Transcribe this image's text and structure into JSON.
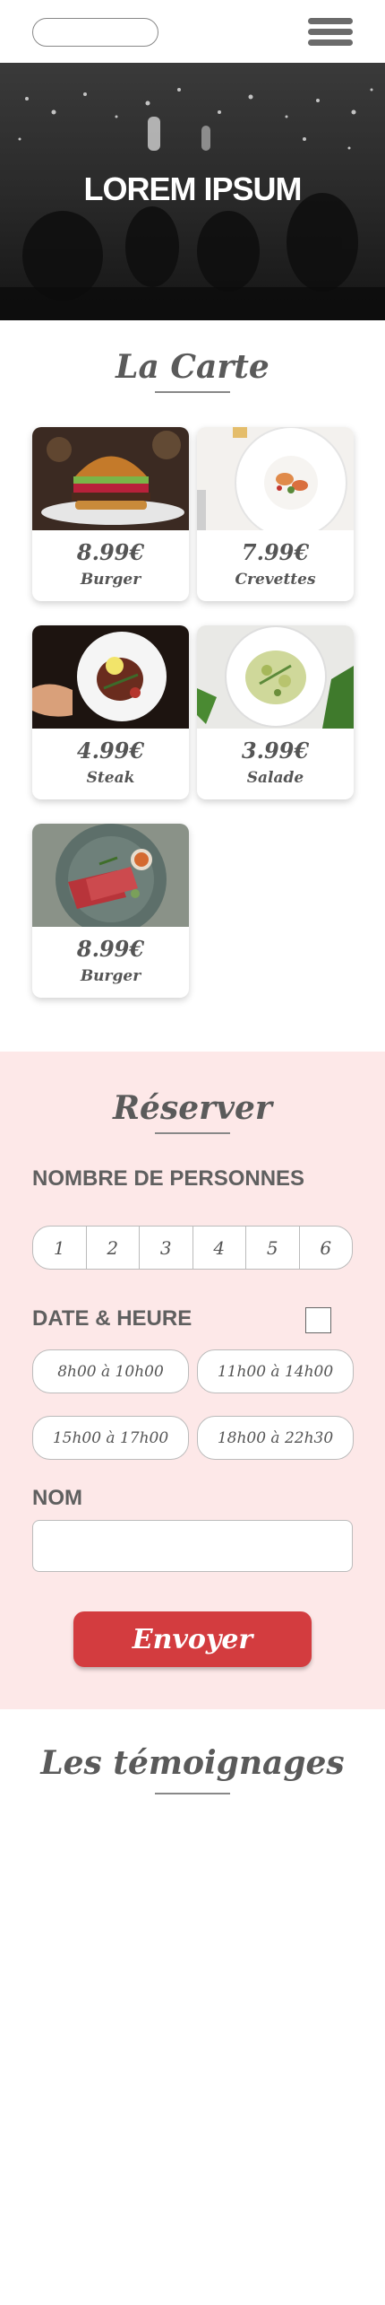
{
  "header": {
    "menu_icon": "hamburger-icon"
  },
  "hero": {
    "title": "LOREM IPSUM"
  },
  "menu": {
    "title": "La Carte",
    "items": [
      {
        "price": "8.99€",
        "name": "Burger"
      },
      {
        "price": "7.99€",
        "name": "Crevettes"
      },
      {
        "price": "4.99€",
        "name": "Steak"
      },
      {
        "price": "3.99€",
        "name": "Salade"
      },
      {
        "price": "8.99€",
        "name": "Burger"
      }
    ]
  },
  "reservation": {
    "title": "Réserver",
    "people_label": "NOMBRE DE PERSONNES",
    "people_options": [
      "1",
      "2",
      "3",
      "4",
      "5",
      "6"
    ],
    "datetime_label": "DATE & HEURE",
    "slots": [
      "8h00 à 10h00",
      "11h00 à 14h00",
      "15h00 à 17h00",
      "18h00 à 22h30"
    ],
    "name_label": "NOM",
    "name_value": "",
    "submit_label": "Envoyer"
  },
  "testimonials": {
    "title": "Les témoignages"
  },
  "colors": {
    "accent": "#d33c3f",
    "reserve_bg": "#fde8e8",
    "text": "#555555"
  }
}
